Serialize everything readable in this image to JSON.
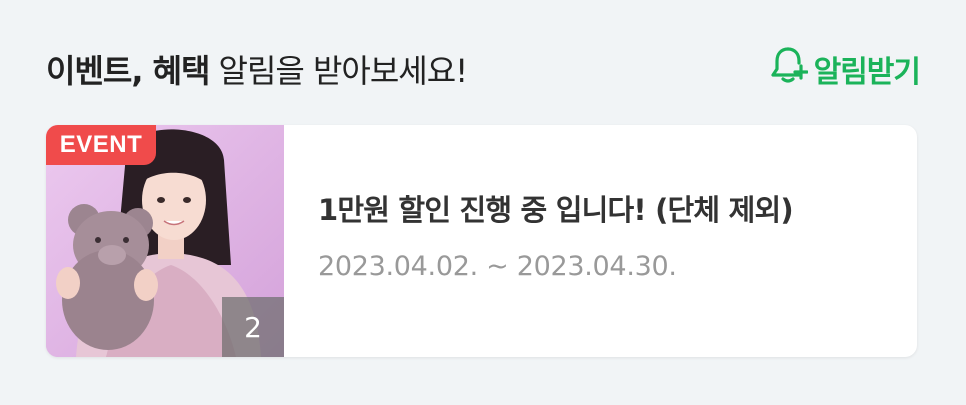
{
  "header": {
    "title_bold": "이벤트, 혜택",
    "title_normal": "알림을 받아보세요!",
    "subscribe_label": "알림받기",
    "subscribe_icon": "bell-plus-icon",
    "accent_color": "#1bb35a"
  },
  "event_card": {
    "badge": "EVENT",
    "badge_color": "#f04b4b",
    "image_count": "2",
    "title": "1만원 할인 진행 중 입니다! (단체 제외)",
    "period": "2023.04.02. ~ 2023.04.30."
  }
}
